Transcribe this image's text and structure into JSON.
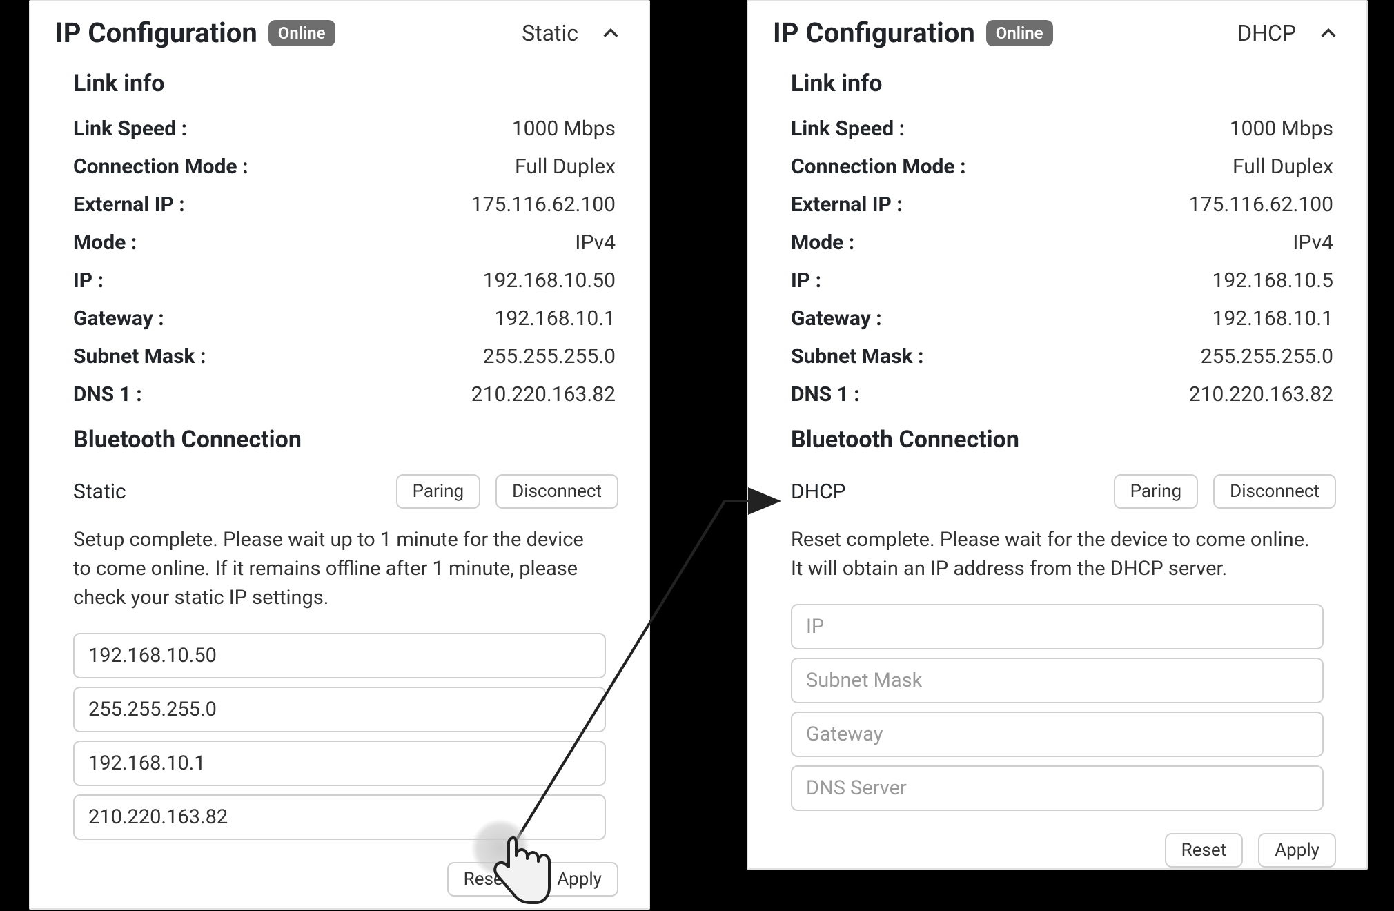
{
  "left": {
    "title": "IP Configuration",
    "badge": "Online",
    "mode_current": "Static",
    "link_info_title": "Link info",
    "link": {
      "speed_label": "Link Speed :",
      "speed_value": "1000 Mbps",
      "conn_mode_label": "Connection Mode :",
      "conn_mode_value": "Full Duplex",
      "ext_ip_label": "External IP :",
      "ext_ip_value": "175.116.62.100",
      "mode_label": "Mode :",
      "mode_value": "IPv4",
      "ip_label": "IP :",
      "ip_value": "192.168.10.50",
      "gateway_label": "Gateway :",
      "gateway_value": "192.168.10.1",
      "subnet_label": "Subnet Mask :",
      "subnet_value": "255.255.255.0",
      "dns1_label": "DNS 1 :",
      "dns1_value": "210.220.163.82"
    },
    "bluetooth_title": "Bluetooth Connection",
    "bluetooth_label": "Static",
    "pairing_btn": "Paring",
    "disconnect_btn": "Disconnect",
    "status": "Setup complete. Please wait up to 1 minute for the device to come online. If it remains offline after 1 minute, please check your static IP settings.",
    "inputs": {
      "ip": "192.168.10.50",
      "subnet": "255.255.255.0",
      "gateway": "192.168.10.1",
      "dns": "210.220.163.82"
    },
    "reset_btn": "Reset",
    "apply_btn": "Apply"
  },
  "right": {
    "title": "IP Configuration",
    "badge": "Online",
    "mode_current": "DHCP",
    "link_info_title": "Link info",
    "link": {
      "speed_label": "Link Speed :",
      "speed_value": "1000 Mbps",
      "conn_mode_label": "Connection Mode :",
      "conn_mode_value": "Full Duplex",
      "ext_ip_label": "External IP :",
      "ext_ip_value": "175.116.62.100",
      "mode_label": "Mode :",
      "mode_value": "IPv4",
      "ip_label": "IP :",
      "ip_value": "192.168.10.5",
      "gateway_label": "Gateway :",
      "gateway_value": "192.168.10.1",
      "subnet_label": "Subnet Mask :",
      "subnet_value": "255.255.255.0",
      "dns1_label": "DNS 1 :",
      "dns1_value": "210.220.163.82"
    },
    "bluetooth_title": "Bluetooth Connection",
    "bluetooth_label": "DHCP",
    "pairing_btn": "Paring",
    "disconnect_btn": "Disconnect",
    "status": "Reset complete. Please wait for the device to come online. It will obtain an IP address from the DHCP server.",
    "placeholders": {
      "ip": "IP",
      "subnet": "Subnet Mask",
      "gateway": "Gateway",
      "dns": "DNS Server"
    },
    "reset_btn": "Reset",
    "apply_btn": "Apply"
  }
}
